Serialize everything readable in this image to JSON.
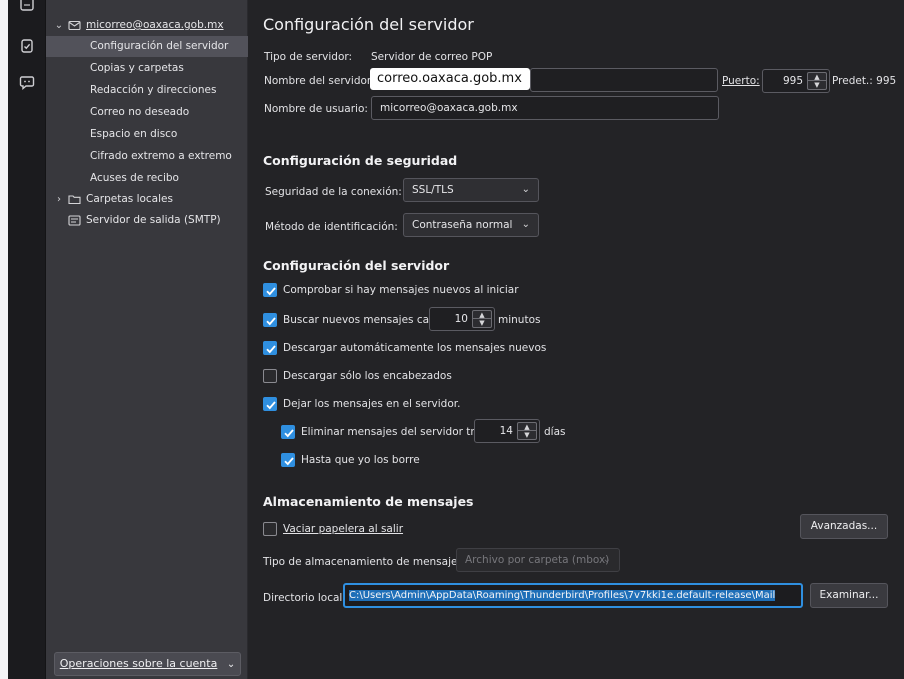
{
  "tree": {
    "account": "micorreo@oaxaca.gob.mx",
    "items": [
      "Configuración del servidor",
      "Copias y carpetas",
      "Redacción y direcciones",
      "Correo no deseado",
      "Espacio en disco",
      "Cifrado extremo a extremo",
      "Acuses de recibo"
    ],
    "local_folders": "Carpetas locales",
    "smtp": "Servidor de salida (SMTP)",
    "operations_button": "Operaciones sobre la cuenta"
  },
  "content": {
    "title": "Configuración del servidor",
    "server_type_label": "Tipo de servidor:",
    "server_type_value": "Servidor de correo POP",
    "server_name_label": "Nombre del servidor:",
    "server_name_value": "correo.oaxaca.gob.mx",
    "port_label": "Puerto:",
    "port_value": "995",
    "default_port": "Predet.: 995",
    "username_label": "Nombre de usuario:",
    "username_value": "micorreo@oaxaca.gob.mx",
    "security": {
      "heading": "Configuración de seguridad",
      "connection_label": "Seguridad de la conexión:",
      "connection_value": "SSL/TLS",
      "auth_label": "Método de identificación:",
      "auth_value": "Contraseña normal"
    },
    "server_settings": {
      "heading": "Configuración del servidor",
      "check_on_start": "Comprobar si hay mensajes nuevos al iniciar",
      "check_every_label": "Buscar nuevos mensajes cada",
      "check_every_value": "10",
      "minutes": "minutos",
      "auto_download": "Descargar automáticamente los mensajes nuevos",
      "headers_only": "Descargar sólo los encabezados",
      "leave_on_server": "Dejar los mensajes en el servidor.",
      "delete_after_label": "Eliminar mensajes del servidor tras",
      "delete_after_value": "14",
      "days": "días",
      "until_deleted": "Hasta que yo los borre"
    },
    "storage": {
      "heading": "Almacenamiento de mensajes",
      "empty_trash": "Vaciar papelera al salir",
      "advanced_button": "Avanzadas...",
      "store_type_label": "Tipo de almacenamiento de mensajes:",
      "store_type_value": "Archivo por carpeta (mbox)",
      "local_dir_label": "Directorio local:",
      "local_dir_value": "C:\\Users\\Admin\\AppData\\Roaming\\Thunderbird\\Profiles\\7v7kki1e.default-release\\Mail",
      "browse_button": "Examinar..."
    }
  },
  "colors": {
    "accent": "#2f8fe0",
    "background": "#232326",
    "tree_background": "#38383d",
    "selected_row": "#52525a"
  }
}
